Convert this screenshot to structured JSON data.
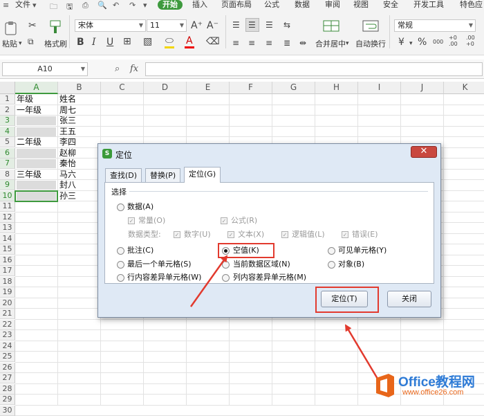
{
  "menu": {
    "file": "文件",
    "tabs": [
      "开始",
      "插入",
      "页面布局",
      "公式",
      "数据",
      "审阅",
      "视图",
      "安全",
      "开发工具",
      "特色应"
    ],
    "active_tab": "开始"
  },
  "ribbon": {
    "paste": "粘贴",
    "format_painter": "格式刷",
    "font_name": "宋体",
    "font_size": "11",
    "font_grow": "A⁺",
    "font_shrink": "A⁻",
    "bold": "B",
    "merge_center": "合并居中",
    "wrap_text": "自动换行",
    "number_format": "常规",
    "percent": "%",
    "thousands": "000",
    "inc_decimal": "+0 .00",
    "dec_decimal": ".00 +0"
  },
  "formula_bar": {
    "name_box": "A10",
    "fx": "fx",
    "value": ""
  },
  "sheet": {
    "columns": [
      "A",
      "B",
      "C",
      "D",
      "E",
      "F",
      "G",
      "H",
      "I",
      "J",
      "K"
    ],
    "selected_column": "A",
    "rows": [
      "1",
      "2",
      "3",
      "4",
      "5",
      "6",
      "7",
      "8",
      "9",
      "10",
      "11",
      "12",
      "13",
      "14",
      "15",
      "16",
      "17",
      "18",
      "19",
      "20",
      "21",
      "22",
      "23",
      "24",
      "25",
      "26",
      "27",
      "28",
      "29",
      "30"
    ],
    "selected_rows": [
      "3",
      "4",
      "6",
      "7",
      "9",
      "10"
    ],
    "cells": {
      "A1": "年级",
      "B1": "姓名",
      "A2": "一年级",
      "B2": "周七",
      "B3": "张三",
      "B4": "王五",
      "A5": "二年级",
      "B5": "李四",
      "B6": "赵柳",
      "B7": "秦怡",
      "A8": "三年级",
      "B8": "马六",
      "B9": "封八",
      "B10": "孙三"
    }
  },
  "dialog": {
    "title": "定位",
    "tabs": [
      "查找(D)",
      "替换(P)",
      "定位(G)"
    ],
    "active_tab": "定位(G)",
    "group_label": "选择",
    "options": {
      "data": "数据(A)",
      "constants": "常量(O)",
      "formulas": "公式(R)",
      "data_types_label": "数据类型:",
      "numbers": "数字(U)",
      "text": "文本(X)",
      "logicals": "逻辑值(L)",
      "errors": "错误(E)",
      "comments": "批注(C)",
      "blanks": "空值(K)",
      "visible_cells": "可见单元格(Y)",
      "last_cell": "最后一个单元格(S)",
      "current_region": "当前数据区域(N)",
      "objects": "对象(B)",
      "row_diffs": "行内容差异单元格(W)",
      "col_diffs": "列内容差异单元格(M)"
    },
    "selected_option": "blanks",
    "ok": "定位(T)",
    "close": "关闭"
  },
  "watermark": {
    "brand": "Office教程网",
    "url": "www.office26.com"
  },
  "colors": {
    "accent_green": "#3e9a3e",
    "annotation_red": "#e23a2e",
    "brand_blue": "#2e7bd6",
    "brand_orange": "#e8661a"
  }
}
